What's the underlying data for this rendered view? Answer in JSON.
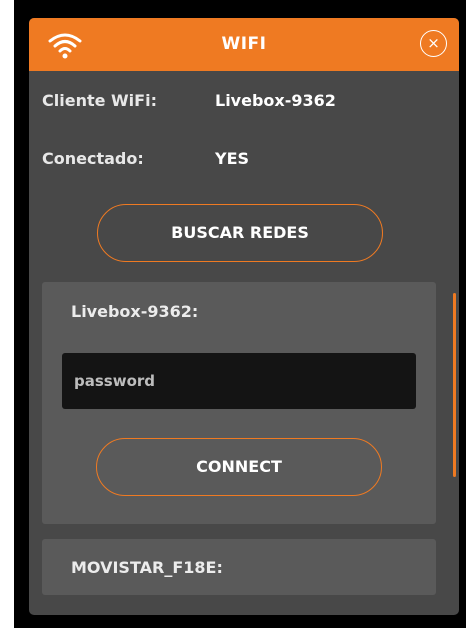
{
  "header": {
    "title": "WIFI",
    "close_glyph": "×",
    "wifi_icon": "wifi-icon",
    "close_icon": "close-icon"
  },
  "info": {
    "client_label": "Cliente WiFi:",
    "client_value": "Livebox-9362",
    "connected_label": "Conectado:",
    "connected_value": "YES"
  },
  "scan_button_label": "BUSCAR REDES",
  "networks": [
    {
      "name": "Livebox-9362:",
      "password_placeholder": "password",
      "connect_label": "CONNECT"
    },
    {
      "name": "MOVISTAR_F18E:"
    }
  ],
  "colors": {
    "accent": "#ef7a22",
    "panel": "#484848",
    "card": "#5a5a5a",
    "input": "#141414"
  }
}
